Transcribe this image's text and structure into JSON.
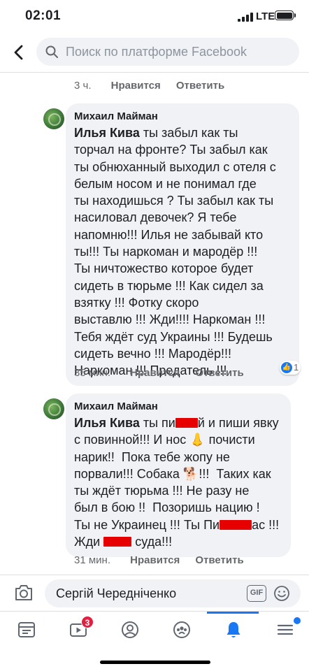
{
  "status_bar": {
    "time": "02:01",
    "network": "LTE"
  },
  "search": {
    "placeholder": "Поиск по платформе Facebook"
  },
  "previous_comment_meta": {
    "time": "3 ч.",
    "like": "Нравится",
    "reply": "Ответить"
  },
  "comments": [
    {
      "author": "Михаил Майман",
      "mention": "Илья Кива",
      "text": " ты забыл как ты\nторчал на фронте? Ты забыл как\nты обнюханный выходил с отеля с\nбелым носом и не понимал где\nты находишься ? Ты забыл как ты\nнасиловал девочек? Я тебе\nнапомню!!! Илья не забывай кто\nты!!! Ты наркоман и мародёр !!!\nТы ничтожество которое будет\nсидеть в тюрьме !!! Как сидел за\nвзятку !!! Фотку скоро\nвыставлю !!! Жди!!!! Наркоман !!!\nТебя ждёт суд Украины !!! Будешь\nсидеть вечно !!! Мародёр!!!\nНаркоман !!! Предатель !!!",
      "time": "35 мин.",
      "like": "Нравится",
      "reply": "Ответить",
      "reaction_count": "1"
    },
    {
      "author": "Михаил Майман",
      "mention": "Илья Кива",
      "line1_a": " ты пи",
      "line1_b": "й и пиши явку",
      "line2": "с повинной!!! И нос 👃 почисти",
      "line3": "нарик!!  Пока тебе жопу не",
      "line4": "порвали!!! Собака 🐕!!!  Таких как",
      "line5": "ты ждёт тюрьма !!! Не разу не",
      "line6": "был в бою !!  Позоришь нацию !",
      "line7_a": "Ты не Украинец !!! Ты Пи",
      "line7_b": "ас !!!",
      "line8_a": "Жди ",
      "line8_b": " суда!!!",
      "time": "31 мин.",
      "like": "Нравится",
      "reply": "Ответить"
    }
  ],
  "composer": {
    "name": "Сергій Чередніченко",
    "gif": "GIF"
  },
  "nav": {
    "video_badge": "3"
  },
  "colors": {
    "accent": "#1877f2",
    "badge": "#e41e3f",
    "redaction": "#e60000"
  }
}
